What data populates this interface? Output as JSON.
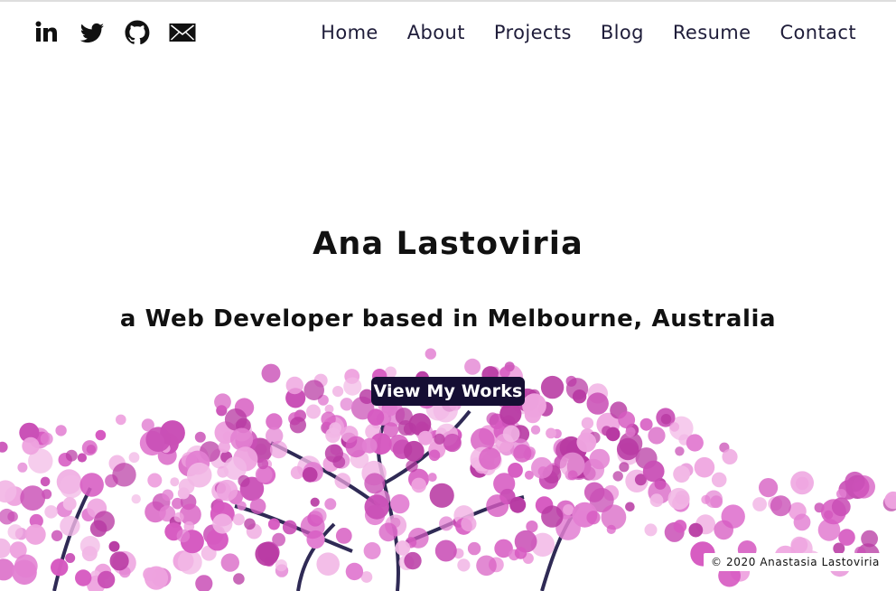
{
  "social": [
    {
      "label": "LinkedIn",
      "icon": "linkedin-icon"
    },
    {
      "label": "Twitter",
      "icon": "twitter-icon"
    },
    {
      "label": "GitHub",
      "icon": "github-icon"
    },
    {
      "label": "Email",
      "icon": "mail-icon"
    }
  ],
  "nav": {
    "items": [
      "Home",
      "About",
      "Projects",
      "Blog",
      "Resume",
      "Contact"
    ]
  },
  "hero": {
    "name": "Ana Lastoviria",
    "tagline": "a Web Developer based in Melbourne, Australia",
    "cta_label": "View My Works"
  },
  "footer": {
    "copyright": "© 2020 Anastasia Lastoviria"
  },
  "colors": {
    "button_bg": "#150e33",
    "nav_text": "#1f1d3a",
    "blossom": "#d95cc4",
    "branch": "#2f2a55"
  }
}
